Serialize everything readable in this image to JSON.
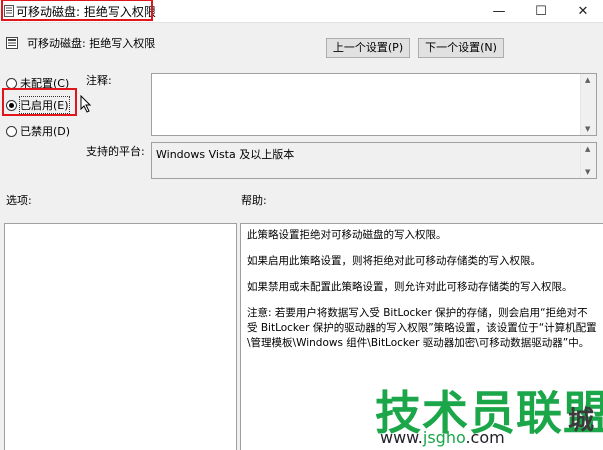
{
  "window": {
    "title": "可移动磁盘: 拒绝写入权限",
    "minimize_label": "—",
    "maximize_label": "☐",
    "close_label": "✕"
  },
  "header": {
    "policy_name": "可移动磁盘: 拒绝写入权限",
    "prev_button": "上一个设置(P)",
    "next_button": "下一个设置(N)"
  },
  "state": {
    "options": [
      {
        "label": "未配置(C)",
        "checked": false
      },
      {
        "label": "已启用(E)",
        "checked": true
      },
      {
        "label": "已禁用(D)",
        "checked": false
      }
    ]
  },
  "comment": {
    "label": "注释:",
    "value": ""
  },
  "supported": {
    "label": "支持的平台:",
    "value": "Windows Vista 及以上版本"
  },
  "options_section": {
    "label": "选项:"
  },
  "help_section": {
    "label": "帮助:",
    "paragraphs": [
      "此策略设置拒绝对可移动磁盘的写入权限。",
      "如果启用此策略设置，则将拒绝对此可移动存储类的写入权限。",
      "如果禁用或未配置此策略设置，则允许对此可移动存储类的写入权限。",
      "注意: 若要用户将数据写入受 BitLocker 保护的存储，则会启用“拒绝对不受 BitLocker 保护的驱动器的写入权限”策略设置，该设置位于“计算机配置\\管理模板\\Windows 组件\\BitLocker 驱动器加密\\可移动数据驱动器”中。"
    ]
  },
  "watermark": {
    "text": "技术员联盟",
    "url_prefix": "www.",
    "url_main": "jsgho",
    "url_suffix": ".com",
    "partial_text": "城"
  },
  "colors": {
    "highlight_red": "#e0161c",
    "watermark_green": "#1ba64a"
  }
}
